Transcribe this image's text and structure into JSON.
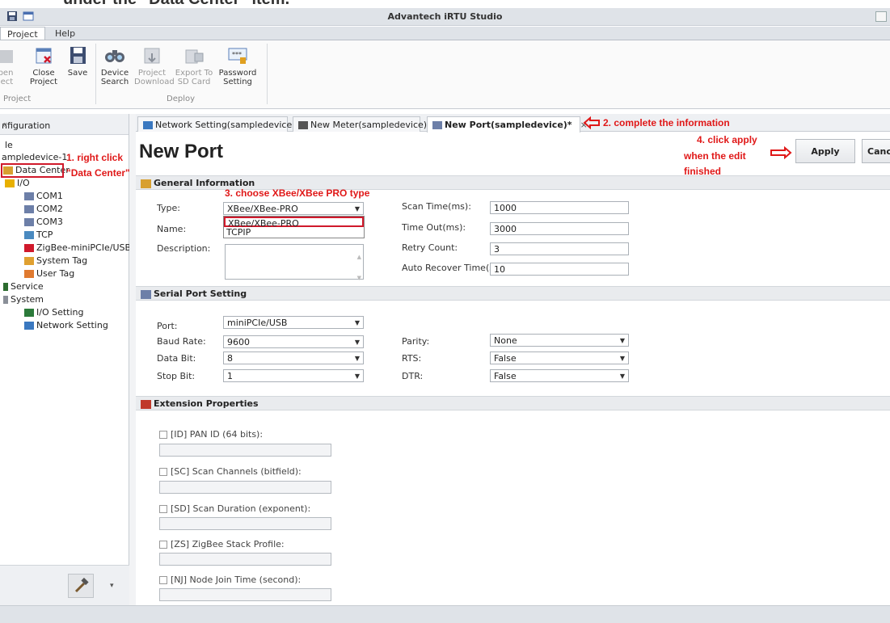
{
  "caption": "under the \"Data Center\" item.",
  "window": {
    "title": "Advantech iRTU Studio"
  },
  "menu": {
    "tabs": [
      "Project",
      "Help"
    ]
  },
  "ribbon": {
    "buttons": [
      {
        "label1": "pen",
        "label2": "ject"
      },
      {
        "label1": "Close",
        "label2": "Project"
      },
      {
        "label1": "Save",
        "label2": ""
      },
      {
        "label1": "Device",
        "label2": "Search"
      },
      {
        "label1": "Project",
        "label2": "Download"
      },
      {
        "label1": "Export To",
        "label2": "SD Card"
      },
      {
        "label1": "Password",
        "label2": "Setting"
      }
    ],
    "groups": [
      "Project",
      "Deploy"
    ]
  },
  "sidebar": {
    "title": "nfiguration",
    "collapse": "«",
    "items": [
      "le",
      "ampledevice-1",
      "Data Center",
      "I/O",
      "COM1",
      "COM2",
      "COM3",
      "TCP",
      "ZigBee-miniPCIe/USB",
      "System Tag",
      "User Tag",
      "Service",
      "System",
      "I/O Setting",
      "Network Setting"
    ]
  },
  "tabs": [
    {
      "label": "Network Setting(sampledevice)"
    },
    {
      "label": "New Meter(sampledevice)"
    },
    {
      "label": "New Port(sampledevice)*",
      "close": "×"
    }
  ],
  "page": {
    "title": "New Port",
    "apply": "Apply",
    "cancel": "Cancel"
  },
  "general": {
    "header": "General Information",
    "type_label": "Type:",
    "type_value": "XBee/XBee-PRO",
    "type_options": [
      "XBee/XBee-PRO",
      "TCPIP"
    ],
    "name_label": "Name:",
    "desc_label": "Description:",
    "scan_label": "Scan Time(ms):",
    "scan_value": "1000",
    "timeout_label": "Time Out(ms):",
    "timeout_value": "3000",
    "retry_label": "Retry Count:",
    "retry_value": "3",
    "recover_label": "Auto Recover Time(s):",
    "recover_value": "10"
  },
  "serial": {
    "header": "Serial Port Setting",
    "port_label": "Port:",
    "port_value": "miniPCIe/USB",
    "baud_label": "Baud Rate:",
    "baud_value": "9600",
    "databit_label": "Data Bit:",
    "databit_value": "8",
    "stopbit_label": "Stop Bit:",
    "stopbit_value": "1",
    "parity_label": "Parity:",
    "parity_value": "None",
    "rts_label": "RTS:",
    "rts_value": "False",
    "dtr_label": "DTR:",
    "dtr_value": "False"
  },
  "extension": {
    "header": "Extension Properties",
    "items": [
      "[ID] PAN ID (64 bits):",
      "[SC] Scan Channels (bitfield):",
      "[SD] Scan Duration (exponent):",
      "[ZS] ZigBee Stack Profile:",
      "[NJ] Node Join Time (second):"
    ]
  },
  "annotations": {
    "step1": "1. right click",
    "step1b": "\"Data Center\"",
    "step2": "2. complete the information",
    "step3": "3. choose XBee/XBee PRO type",
    "step4a": "4. click apply",
    "step4b": "when the edit",
    "step4c": "finished"
  },
  "colors": {
    "annotation": "#e01818",
    "ribbon_bg": "#fafafa",
    "chrome": "#dfe3e8"
  }
}
